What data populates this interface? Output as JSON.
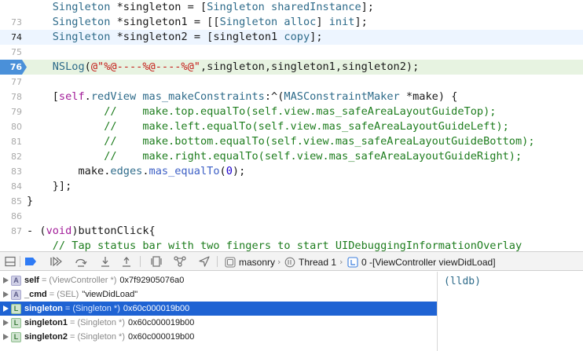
{
  "editor": {
    "lines": [
      {
        "num": "",
        "tokens": [
          [
            "t-plain",
            "    "
          ],
          [
            "t-type",
            "Singleton"
          ],
          [
            "t-plain",
            " *singleton = ["
          ],
          [
            "t-type",
            "Singleton"
          ],
          [
            "t-plain",
            " "
          ],
          [
            "t-method",
            "sharedInstance"
          ],
          [
            "t-plain",
            "];"
          ]
        ]
      },
      {
        "num": "73",
        "tokens": [
          [
            "t-plain",
            "    "
          ],
          [
            "t-type",
            "Singleton"
          ],
          [
            "t-plain",
            " *singleton1 = [["
          ],
          [
            "t-type",
            "Singleton"
          ],
          [
            "t-plain",
            " "
          ],
          [
            "t-method",
            "alloc"
          ],
          [
            "t-plain",
            "] "
          ],
          [
            "t-method",
            "init"
          ],
          [
            "t-plain",
            "];"
          ]
        ]
      },
      {
        "num": "74",
        "current": true,
        "tokens": [
          [
            "t-plain",
            "    "
          ],
          [
            "t-type",
            "Singleton"
          ],
          [
            "t-plain",
            " *singleton2 = [singleton1 "
          ],
          [
            "t-method",
            "copy"
          ],
          [
            "t-plain",
            "];"
          ]
        ]
      },
      {
        "num": "75",
        "tokens": []
      },
      {
        "num": "76",
        "breakpoint": true,
        "tokens": [
          [
            "t-plain",
            "    "
          ],
          [
            "t-method",
            "NSLog"
          ],
          [
            "t-plain",
            "("
          ],
          [
            "t-string",
            "@\"%@----%@----%@\""
          ],
          [
            "t-plain",
            ",singleton,singleton1,singleton2);"
          ]
        ]
      },
      {
        "num": "77",
        "tokens": []
      },
      {
        "num": "78",
        "tokens": [
          [
            "t-plain",
            "    ["
          ],
          [
            "t-keyword",
            "self"
          ],
          [
            "t-plain",
            "."
          ],
          [
            "t-method",
            "redView"
          ],
          [
            "t-plain",
            " "
          ],
          [
            "t-method",
            "mas_makeConstraints"
          ],
          [
            "t-plain",
            ":^("
          ],
          [
            "t-type",
            "MASConstraintMaker"
          ],
          [
            "t-plain",
            " *make) {"
          ]
        ]
      },
      {
        "num": "79",
        "tokens": [
          [
            "t-comment",
            "            //    make.top.equalTo(self.view.mas_safeAreaLayoutGuideTop);"
          ]
        ]
      },
      {
        "num": "80",
        "tokens": [
          [
            "t-comment",
            "            //    make.left.equalTo(self.view.mas_safeAreaLayoutGuideLeft);"
          ]
        ]
      },
      {
        "num": "81",
        "tokens": [
          [
            "t-comment",
            "            //    make.bottom.equalTo(self.view.mas_safeAreaLayoutGuideBottom);"
          ]
        ]
      },
      {
        "num": "82",
        "tokens": [
          [
            "t-comment",
            "            //    make.right.equalTo(self.view.mas_safeAreaLayoutGuideRight);"
          ]
        ]
      },
      {
        "num": "83",
        "tokens": [
          [
            "t-plain",
            "        make."
          ],
          [
            "t-method",
            "edges"
          ],
          [
            "t-plain",
            "."
          ],
          [
            "t-macro",
            "mas_equalTo"
          ],
          [
            "t-plain",
            "("
          ],
          [
            "t-number",
            "0"
          ],
          [
            "t-plain",
            ");"
          ]
        ]
      },
      {
        "num": "84",
        "tokens": [
          [
            "t-plain",
            "    }];"
          ]
        ]
      },
      {
        "num": "85",
        "tokens": [
          [
            "t-plain",
            "}"
          ]
        ]
      },
      {
        "num": "86",
        "tokens": []
      },
      {
        "num": "87",
        "tokens": [
          [
            "t-plain",
            "- ("
          ],
          [
            "t-keyword",
            "void"
          ],
          [
            "t-plain",
            ")buttonClick{"
          ]
        ]
      },
      {
        "num": "",
        "tokens": [
          [
            "t-comment",
            "    // Tap status bar with two fingers to start UIDebuggingInformationOverlay"
          ]
        ]
      }
    ]
  },
  "debug_bar": {
    "breadcrumbs": [
      {
        "label": "masonry",
        "icon": "app-target-icon"
      },
      {
        "label": "Thread 1",
        "icon": "thread-icon"
      },
      {
        "label": "0 -[ViewController viewDidLoad]",
        "icon": "stack-frame-icon"
      }
    ]
  },
  "variables": [
    {
      "badge": "A",
      "kind": "arg",
      "name": "self",
      "type": "(ViewController *)",
      "value": "0x7f92905076a0",
      "selected": false
    },
    {
      "badge": "A",
      "kind": "arg",
      "name": "_cmd",
      "type": "(SEL)",
      "value": "\"viewDidLoad\"",
      "selected": false
    },
    {
      "badge": "L",
      "kind": "local",
      "name": "singleton",
      "type": "(Singleton *)",
      "value": "0x60c000019b00",
      "selected": true
    },
    {
      "badge": "L",
      "kind": "local",
      "name": "singleton1",
      "type": "(Singleton *)",
      "value": "0x60c000019b00",
      "selected": false
    },
    {
      "badge": "L",
      "kind": "local",
      "name": "singleton2",
      "type": "(Singleton *)",
      "value": "0x60c000019b00",
      "selected": false
    }
  ],
  "console": {
    "prompt": "(lldb)"
  },
  "colors": {
    "breakpoint": "#4a90d9",
    "selection": "#1f63d3",
    "comment": "#1e7d1e",
    "type": "#2e6b8a",
    "string": "#c41a16",
    "keyword": "#a21d99"
  }
}
